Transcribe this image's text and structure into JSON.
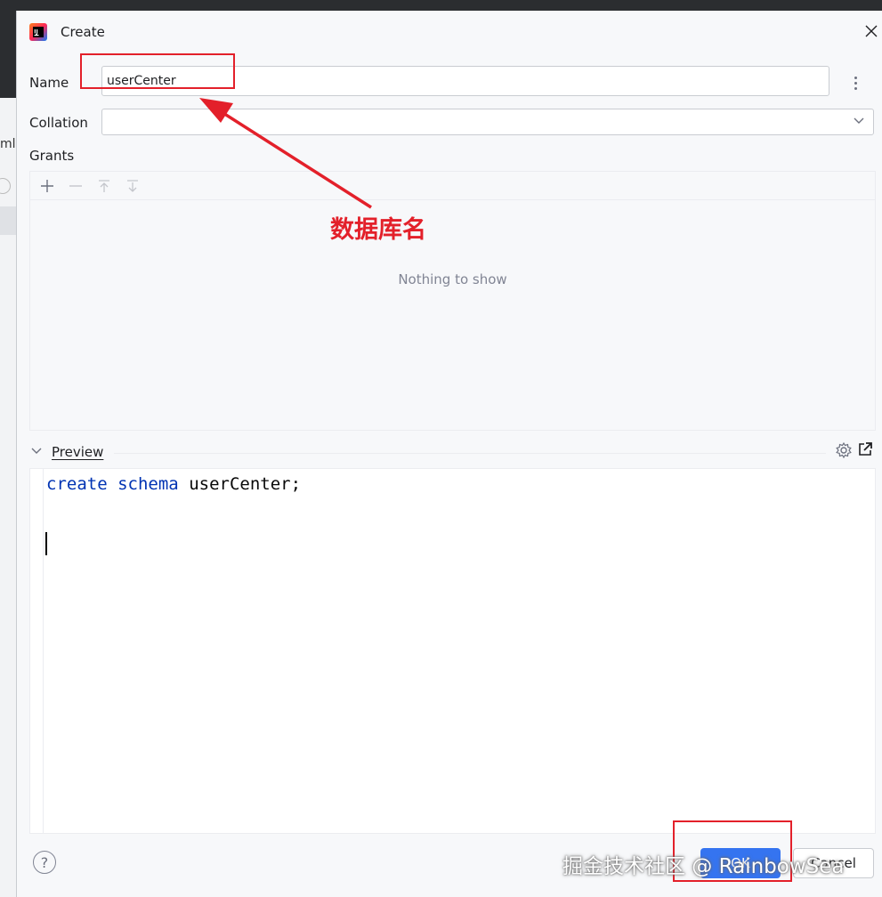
{
  "dialog": {
    "title": "Create",
    "name_label": "Name",
    "name_value": "userCenter",
    "collation_label": "Collation",
    "collation_value": "",
    "grants_label": "Grants",
    "grants_empty": "Nothing to show",
    "preview_label": "Preview",
    "preview_code": {
      "kw1": "create",
      "kw2": "schema",
      "ident": "userCenter;"
    },
    "help_label": "?",
    "ok_label": "OK",
    "cancel_label": "Cancel"
  },
  "background": {
    "left_text": "ml"
  },
  "annotation": {
    "label": "数据库名",
    "color": "#e3202a"
  },
  "watermark": {
    "text": "掘金技术社区 @ RainbowSea"
  },
  "icons": {
    "app": "intellij-icon",
    "close": "close-icon",
    "more": "more-vertical-icon",
    "dropdown": "chevron-down-icon",
    "add": "add-icon",
    "remove": "remove-icon",
    "move_up": "arrow-up-icon",
    "move_down": "arrow-down-icon",
    "collapse": "chevron-down-icon",
    "settings": "gear-icon",
    "open_external": "open-external-icon"
  },
  "colors": {
    "accent": "#3574f0",
    "keyword": "#0033b3"
  }
}
